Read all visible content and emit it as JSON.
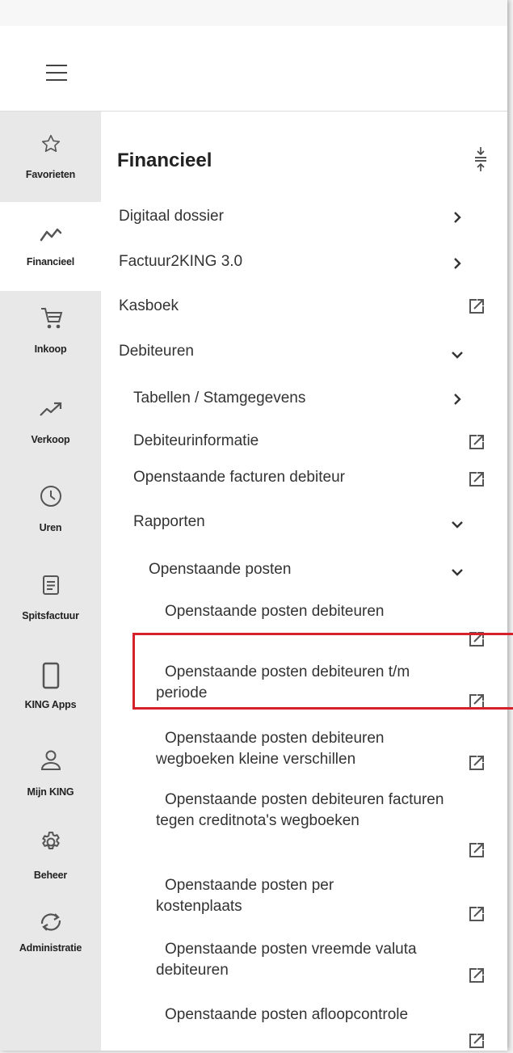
{
  "sidebar": {
    "items": [
      {
        "label": "Favorieten",
        "icon": "star-icon"
      },
      {
        "label": "Financieel",
        "icon": "trend-line-icon"
      },
      {
        "label": "Inkoop",
        "icon": "cart-icon"
      },
      {
        "label": "Verkoop",
        "icon": "trending-up-icon"
      },
      {
        "label": "Uren",
        "icon": "clock-icon"
      },
      {
        "label": "Spitsfactuur",
        "icon": "document-icon"
      },
      {
        "label": "KING Apps",
        "icon": "mobile-icon"
      },
      {
        "label": "Mijn KING",
        "icon": "user-icon"
      },
      {
        "label": "Beheer",
        "icon": "gear-icon"
      },
      {
        "label": "Administratie",
        "icon": "sync-icon"
      }
    ]
  },
  "menu": {
    "title": "Financieel",
    "items": [
      "Digitaal dossier",
      "Factuur2KING 3.0",
      "Kasboek",
      "Debiteuren",
      "Tabellen / Stamgegevens",
      "Debiteurinformatie",
      "Openstaande facturen debiteur",
      "Rapporten",
      "Openstaande posten",
      "Openstaande posten debiteuren",
      "Openstaande posten debiteuren t/m periode",
      "Openstaande posten debiteuren wegboeken kleine verschillen",
      "Openstaande posten debiteuren facturen tegen creditnota's wegboeken",
      "Openstaande posten per kostenplaats",
      "Openstaande posten vreemde valuta debiteuren",
      "Openstaande posten afloopcontrole"
    ]
  },
  "colors": {
    "highlight": "#d6202a",
    "active_bg": "#ffffff",
    "sidebar_bg": "#e8e8e8"
  }
}
